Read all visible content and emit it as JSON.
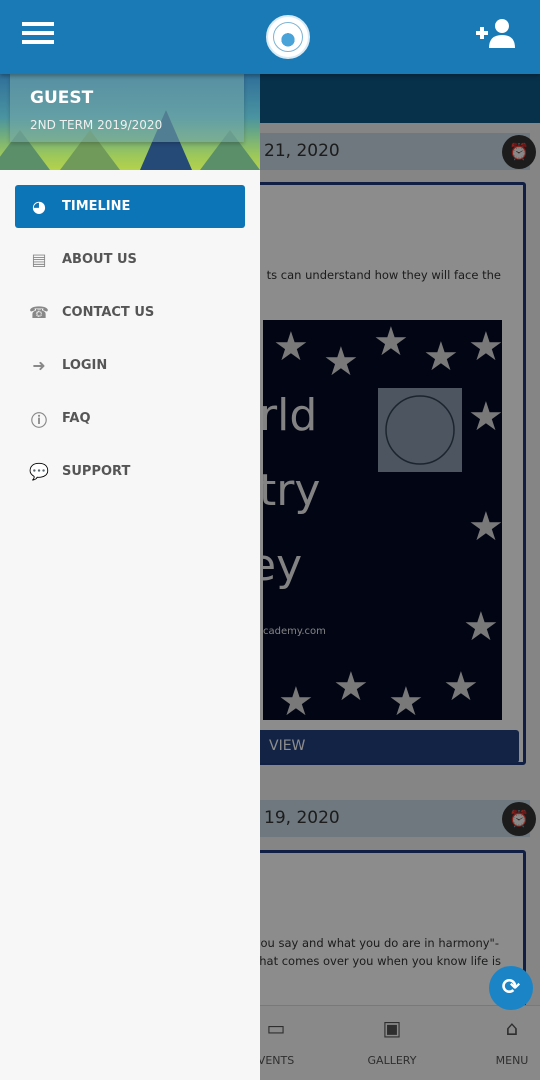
{
  "header": {
    "menu_icon": "hamburger-icon",
    "logo": "school-logo",
    "add_user_icon": "user-plus-icon"
  },
  "drawer": {
    "user_name": "GUEST",
    "term": "2ND TERM 2019/2020",
    "items": [
      {
        "label": "TIMELINE",
        "icon": "tachometer-icon",
        "active": true
      },
      {
        "label": "ABOUT US",
        "icon": "id-card-icon"
      },
      {
        "label": "CONTACT US",
        "icon": "phone-icon"
      },
      {
        "label": "LOGIN",
        "icon": "sign-in-icon"
      },
      {
        "label": "FAQ",
        "icon": "info-icon"
      },
      {
        "label": "SUPPORT",
        "icon": "comments-icon"
      }
    ]
  },
  "timeline": [
    {
      "date": "21, 2020",
      "text": "ts can understand how they will face the",
      "poster_lines": [
        "rld",
        "try",
        "ey"
      ],
      "poster_url": "cademy.com",
      "button": "VIEW"
    },
    {
      "date": "19, 2020",
      "text_lines": [
        "t you say and what you do are in harmony\"-",
        "g that comes over you when you know life is"
      ]
    }
  ],
  "bottom_nav": [
    {
      "label": "VENTS",
      "icon": "calendar-icon"
    },
    {
      "label": "GALLERY",
      "icon": "image-icon"
    },
    {
      "label": "MENU",
      "icon": "home-icon"
    }
  ],
  "fab_icon": "refresh-icon",
  "colors": {
    "header": "#1a7ab6",
    "active": "#0c75b8",
    "card_border": "#1e3a7a"
  }
}
